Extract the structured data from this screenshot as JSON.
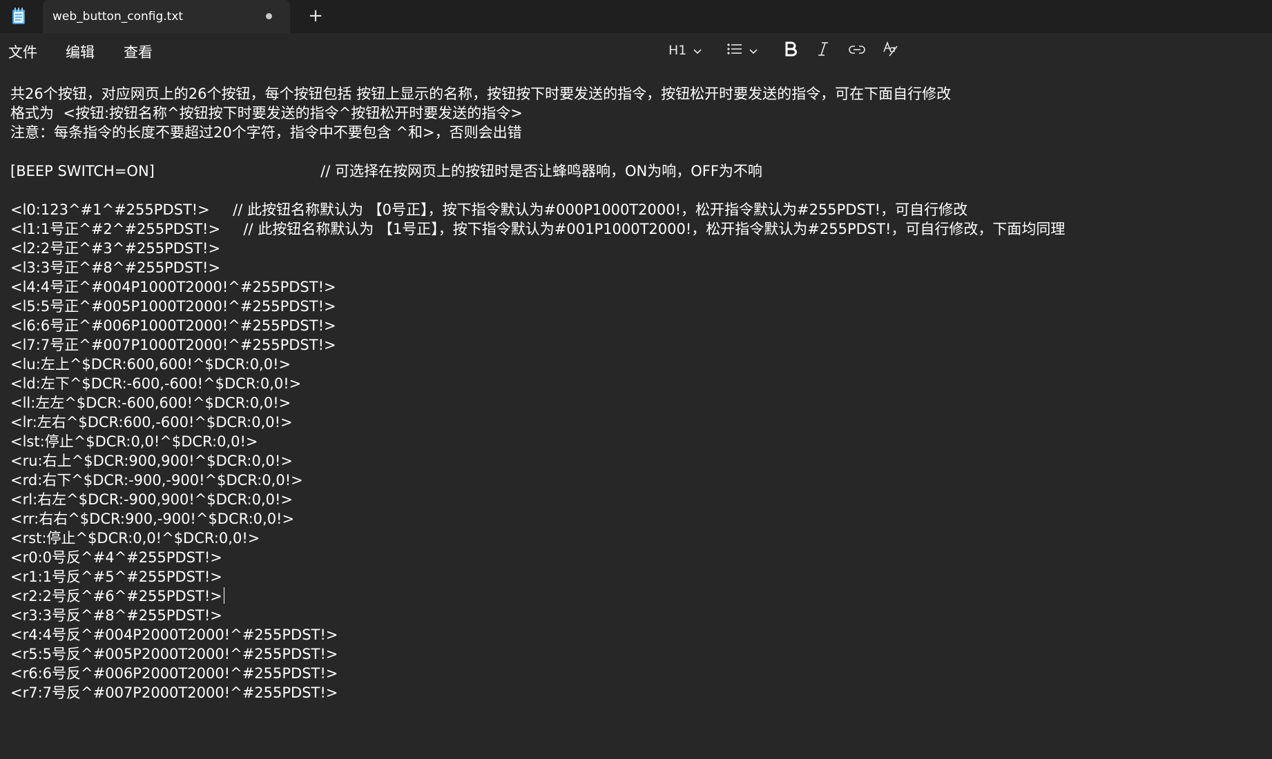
{
  "tab": {
    "title": "web_button_config.txt",
    "new_tab": "+"
  },
  "menu": [
    "文件",
    "编辑",
    "查看"
  ],
  "toolbar": {
    "heading": "H1"
  },
  "icons": {
    "app": "notepad-icon",
    "heading_chevron": "chevron-down-icon",
    "list": "bulleted-list-icon",
    "list_chevron": "chevron-down-icon",
    "bold": "bold-icon",
    "italic": "italic-icon",
    "link": "link-icon",
    "spell": "spellcheck-icon"
  },
  "colors": {
    "background": "#272727",
    "titlebar": "#1f1f1f",
    "text": "#ffffff"
  },
  "document": {
    "lines": [
      "共26个按钮，对应网页上的26个按钮，每个按钮包括 按钮上显示的名称，按钮按下时要发送的指令，按钮松开时要发送的指令，可在下面自行修改",
      "格式为  <按钮:按钮名称^按钮按下时要发送的指令^按钮松开时要发送的指令>",
      "注意：每条指令的长度不要超过20个字符，指令中不要包含 ^和>，否则会出错",
      "",
      "[BEEP SWITCH=ON]                                    // 可选择在按网页上的按钮时是否让蜂鸣器响，ON为响，OFF为不响",
      "",
      "<l0:123^#1^#255PDST!>     // 此按钮名称默认为 【0号正】，按下指令默认为#000P1000T2000!，松开指令默认为#255PDST!，可自行修改",
      "<l1:1号正^#2^#255PDST!>     // 此按钮名称默认为 【1号正】，按下指令默认为#001P1000T2000!，松开指令默认为#255PDST!，可自行修改，下面均同理",
      "<l2:2号正^#3^#255PDST!>",
      "<l3:3号正^#8^#255PDST!>",
      "<l4:4号正^#004P1000T2000!^#255PDST!>",
      "<l5:5号正^#005P1000T2000!^#255PDST!>",
      "<l6:6号正^#006P1000T2000!^#255PDST!>",
      "<l7:7号正^#007P1000T2000!^#255PDST!>",
      "<lu:左上^$DCR:600,600!^$DCR:0,0!>",
      "<ld:左下^$DCR:-600,-600!^$DCR:0,0!>",
      "<ll:左左^$DCR:-600,600!^$DCR:0,0!>",
      "<lr:左右^$DCR:600,-600!^$DCR:0,0!>",
      "<lst:停止^$DCR:0,0!^$DCR:0,0!>",
      "<ru:右上^$DCR:900,900!^$DCR:0,0!>",
      "<rd:右下^$DCR:-900,-900!^$DCR:0,0!>",
      "<rl:右左^$DCR:-900,900!^$DCR:0,0!>",
      "<rr:右右^$DCR:900,-900!^$DCR:0,0!>",
      "<rst:停止^$DCR:0,0!^$DCR:0,0!>",
      "<r0:0号反^#4^#255PDST!>",
      "<r1:1号反^#5^#255PDST!>",
      "<r2:2号反^#6^#255PDST!>",
      "<r3:3号反^#8^#255PDST!>",
      "<r4:4号反^#004P2000T2000!^#255PDST!>",
      "<r5:5号反^#005P2000T2000!^#255PDST!>",
      "<r6:6号反^#006P2000T2000!^#255PDST!>",
      "<r7:7号反^#007P2000T2000!^#255PDST!>"
    ]
  }
}
